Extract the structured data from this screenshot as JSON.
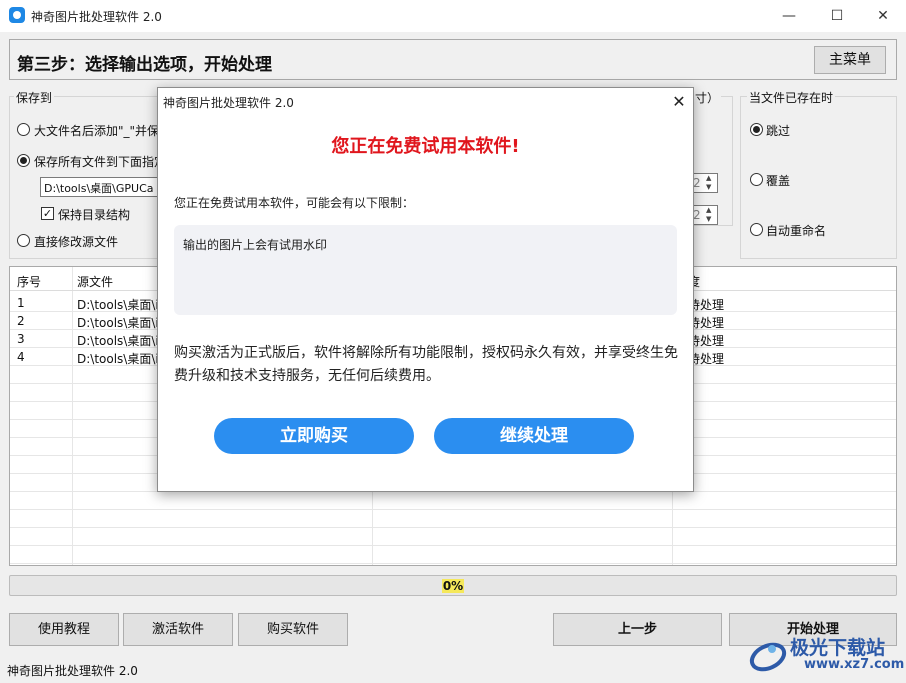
{
  "window": {
    "title": "神奇图片批处理软件 2.0",
    "minimize_glyph": "—",
    "maximize_glyph": "☐",
    "close_glyph": "✕"
  },
  "header": {
    "step_title": "第三步：选择输出选项，开始处理",
    "main_menu_label": "主菜单"
  },
  "save_to": {
    "group_label": "保存到",
    "options": [
      {
        "label": "大文件名后添加\"_\"并保",
        "selected": false
      },
      {
        "label": "保存所有文件到下面指定",
        "selected": true
      },
      {
        "label": "直接修改源文件",
        "selected": false
      }
    ],
    "path_value": "D:\\tools\\桌面\\GPUCa",
    "keep_structure_label": "保持目录结构",
    "keep_structure_checked": true
  },
  "middle": {
    "partial_label": "寸）",
    "spinner1_value": "2",
    "spinner2_value": "2"
  },
  "when_exists": {
    "group_label": "当文件已存在时",
    "options": [
      {
        "label": "跳过",
        "selected": true
      },
      {
        "label": "覆盖",
        "selected": false
      },
      {
        "label": "自动重命名",
        "selected": false
      }
    ]
  },
  "table": {
    "columns": [
      "序号",
      "源文件",
      "度"
    ],
    "rows": [
      {
        "index": "1",
        "source": "D:\\tools\\桌面\\i",
        "status": "待处理"
      },
      {
        "index": "2",
        "source": "D:\\tools\\桌面\\i",
        "status": "待处理"
      },
      {
        "index": "3",
        "source": "D:\\tools\\桌面\\i",
        "status": "待处理"
      },
      {
        "index": "4",
        "source": "D:\\tools\\桌面\\i",
        "status": "待处理"
      }
    ]
  },
  "progress": {
    "text": "0%",
    "fraction": 0
  },
  "buttons": {
    "tutorial": "使用教程",
    "activate": "激活软件",
    "buy": "购买软件",
    "prev": "上一步",
    "start": "开始处理"
  },
  "statusbar": {
    "text": "神奇图片批处理软件 2.0"
  },
  "watermark": {
    "text": "极光下载站",
    "url": "www.xz7.com"
  },
  "dialog": {
    "title": "神奇图片批处理软件 2.0",
    "close_glyph": "✕",
    "heading": "您正在免费试用本软件!",
    "subtitle": "您正在免费试用本软件，可能会有以下限制：",
    "limits": "输出的图片上会有试用水印",
    "body": "购买激活为正式版后，软件将解除所有功能限制，授权码永久有效，并享受终生免费升级和技术支持服务，无任何后续费用。",
    "buy_now_label": "立即购买",
    "continue_label": "继续处理"
  },
  "colors": {
    "accent_blue": "#2b8ef0",
    "heading_red": "#e0161d",
    "progress_highlight": "#f5e85a"
  }
}
